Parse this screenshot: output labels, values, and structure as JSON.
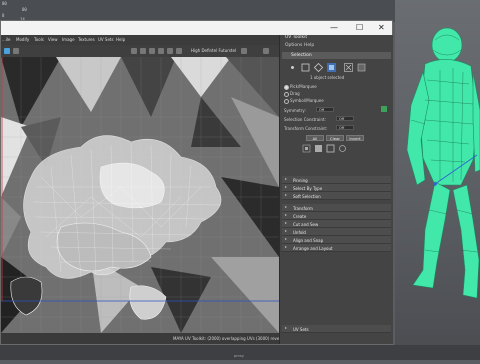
{
  "background_numbers": [
    "00",
    "00",
    "8",
    "14",
    "05",
    "0",
    "02"
  ],
  "window": {
    "minimize_glyph": "—",
    "maximize_glyph": "☐",
    "close_glyph": "✕"
  },
  "menu": [
    "...ile",
    "Modify",
    "Tools",
    "View",
    "Image",
    "Textures",
    "UV Sets",
    "Help"
  ],
  "toolbar": {
    "hd_label": "High Defintel Futurstel"
  },
  "status_text": "MAYA UV Toolkit: (2000) overlapping UVs  (3000) reversed UVs",
  "panel": {
    "title": "UV Toolkit",
    "menu": [
      "Options",
      "Help"
    ],
    "selection_header": "Selection",
    "selected_count": "1 object selected",
    "modes": [
      "Pick/Marquee",
      "Drag",
      "Symbol/Marquee"
    ],
    "symmetry_label": "Symmetry:",
    "symmetry_value": "Off",
    "selection_constraint_label": "Selection Constraint:",
    "selection_constraint_value": "Off",
    "transform_constraint_label": "Transform Constraint:",
    "transform_constraint_value": "Off",
    "buttons": [
      "All",
      "Clear",
      "Invert"
    ],
    "sections": [
      "Pinning",
      "Select By Type",
      "Soft Selection",
      "Transform",
      "Create",
      "Cut and Sew",
      "Unfold",
      "Align and Snap",
      "Arrange and Layout"
    ],
    "uv_sets_label": "UV Sets"
  },
  "bottom_label": "pnmy",
  "colors": {
    "accent": "#4aa3df",
    "model_green": "#41e8a9",
    "titlebar": "#f3f3f3",
    "panel_bg": "#444444"
  }
}
